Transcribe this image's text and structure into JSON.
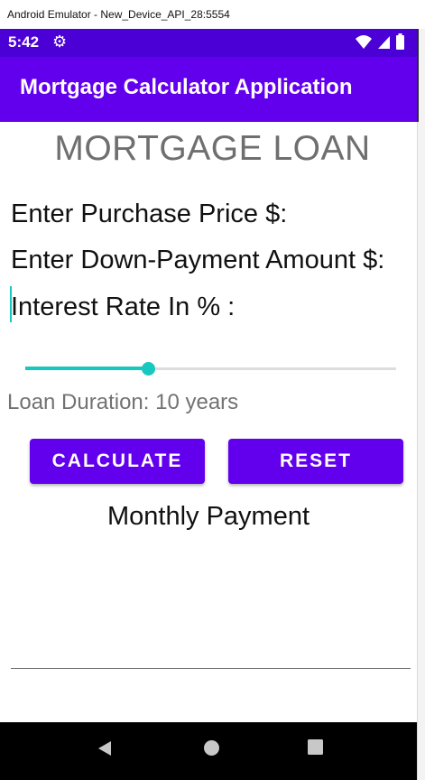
{
  "window": {
    "title": "Android Emulator - New_Device_API_28:5554"
  },
  "status_bar": {
    "time": "5:42",
    "left_icons": [
      "gear-icon"
    ],
    "right_icons": [
      "wifi-icon",
      "signal-icon",
      "battery-icon"
    ],
    "color": "#4b00d6"
  },
  "app_bar": {
    "title": "Mortgage Calculator Application",
    "color": "#6200ee"
  },
  "form": {
    "heading": "MORTGAGE LOAN",
    "purchase_price_placeholder": "Enter Purchase Price $:",
    "down_payment_placeholder": "Enter Down-Payment Amount $:",
    "interest_rate_placeholder": "Interest Rate In % :",
    "slider": {
      "value_fraction": 0.33,
      "accent_color": "#17c8bf"
    },
    "loan_duration_label": "Loan Duration: 10 years"
  },
  "buttons": {
    "calculate": "CALCULATE",
    "reset": "RESET"
  },
  "result": {
    "label": "Monthly Payment",
    "value": ""
  },
  "nav_bar": {
    "icons": [
      "back-icon",
      "home-icon",
      "recents-icon"
    ]
  }
}
